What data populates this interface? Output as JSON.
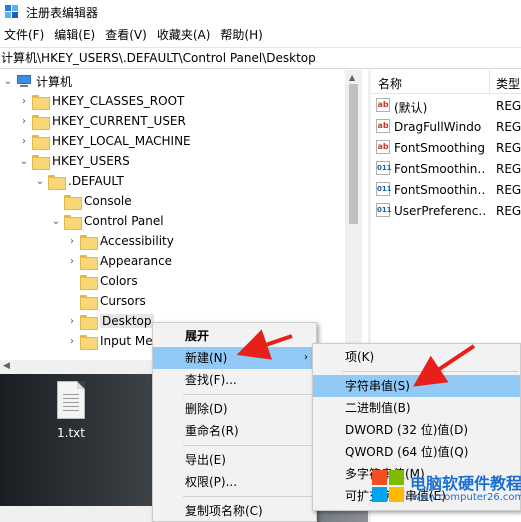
{
  "window": {
    "title": "注册表编辑器"
  },
  "menubar": {
    "items": [
      "文件(F)",
      "编辑(E)",
      "查看(V)",
      "收藏夹(A)",
      "帮助(H)"
    ]
  },
  "address": {
    "path": "计算机\\HKEY_USERS\\.DEFAULT\\Control Panel\\Desktop"
  },
  "tree": {
    "root": "计算机",
    "items": [
      {
        "label": "HKEY_CLASSES_ROOT",
        "expander": "›"
      },
      {
        "label": "HKEY_CURRENT_USER",
        "expander": "›"
      },
      {
        "label": "HKEY_LOCAL_MACHINE",
        "expander": "›"
      },
      {
        "label": "HKEY_USERS",
        "expander": "⌄"
      },
      {
        "label": ".DEFAULT",
        "expander": "⌄"
      },
      {
        "label": "Console",
        "expander": ""
      },
      {
        "label": "Control Panel",
        "expander": "⌄"
      },
      {
        "label": "Accessibility",
        "expander": "›"
      },
      {
        "label": "Appearance",
        "expander": "›"
      },
      {
        "label": "Colors",
        "expander": ""
      },
      {
        "label": "Cursors",
        "expander": ""
      },
      {
        "label": "Desktop",
        "expander": "›"
      },
      {
        "label": "Input Me",
        "expander": "›"
      }
    ]
  },
  "list": {
    "headers": {
      "name": "名称",
      "type": "类型"
    },
    "rows": [
      {
        "name": "(默认)",
        "type": "REG",
        "icon": "ab"
      },
      {
        "name": "DragFullWindo",
        "type": "REG",
        "icon": "ab"
      },
      {
        "name": "FontSmoothing",
        "type": "REG",
        "icon": "ab"
      },
      {
        "name": "FontSmoothin…",
        "type": "REG",
        "icon": "011"
      },
      {
        "name": "FontSmoothin…",
        "type": "REG",
        "icon": "011"
      },
      {
        "name": "UserPreferenc…",
        "type": "REG",
        "icon": "011"
      }
    ]
  },
  "desktop": {
    "file_label": "1.txt"
  },
  "context_menu": {
    "items": [
      "展开",
      "新建(N)",
      "查找(F)...",
      "删除(D)",
      "重命名(R)",
      "导出(E)",
      "权限(P)...",
      "复制项名称(C)"
    ],
    "submenu_arrow": "›"
  },
  "submenu": {
    "items": [
      "项(K)",
      "字符串值(S)",
      "二进制值(B)",
      "DWORD (32 位)值(D)",
      "QWORD (64 位)值(Q)",
      "多字符串值(M)",
      "可扩充字符串值(E)"
    ]
  },
  "watermark": {
    "line1": "电脑软硬件教程网",
    "line2": "www.computer26.com"
  },
  "colors": {
    "highlight": "#91c9f7",
    "arrow": "#e8201a",
    "menu_bg": "#f2f2f2"
  }
}
